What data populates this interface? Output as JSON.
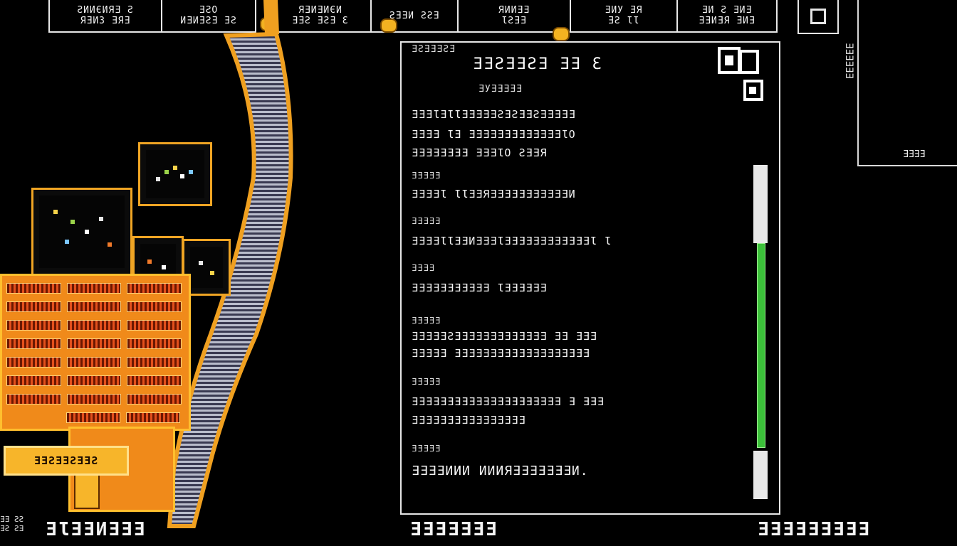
{
  "top_tabs": [
    {
      "line1": "ƧИИЄИЯƎ Ƨ",
      "line2": "ЯƎИЗ ƎЯƎ"
    },
    {
      "line1": "ƎƧO",
      "line2": "ИƎИƎƧƎ ƎƧ"
    },
    {
      "line1": "ЯƎИƎИЄИ",
      "line2": "ƎƎƧ ƎƧƎ Ɛ"
    },
    {
      "line1": "ƧƎƎИ ƧƧƎ",
      "line2": ""
    },
    {
      "line1": "ЯИИƎƎ",
      "line2": "ƖƧƎƎ"
    },
    {
      "line1": "ƎИУ ƎЯ",
      "line2": "ƎƧ ƖƖ"
    },
    {
      "line1": "ƎИ Ƨ ƎИƎ",
      "line2": "ƎƎИƎЯ ƎИƎ"
    }
  ],
  "left_scene": {
    "plate_label": "ƎƎƧƎƎƧƎƎƧ",
    "bottom_small": "ƎƎ ƧƧ\nƎƧ ƧƎ",
    "bottom_label": "ƎƖƎƎИƎƎƎ"
  },
  "info_panel": {
    "tag": "ƎƧƎƎƎƧƎ",
    "title": "ƎƎƧƎƎƧƎ ƎƎ Ɛ",
    "subtitle": "ƎУƎƎƎƎƎ",
    "intro_lines": [
      "ƎƎƎƖƎƖƖƎƎƎƎƎƧƎƧƎƎƧƎƎƎƎƎ",
      "ƎƎƎƎ ƖƎ ƎƎƎƎƎƎƎƎƎƎƎƎƎƖO",
      "ƎƎƎƎƎƎƎƎ ƎƎƎƖO ƧƎƎЯ"
    ],
    "sections": [
      {
        "label": "ƎƎƎƎƎ",
        "lines": [
          "ƎƎƎƎƖ ƖƖƎƎЯƎƎƎƎƎƎƎƎƎƎƎИ"
        ]
      },
      {
        "label": "ƎƎƎƎƎ",
        "lines": [
          "ƎƎƎƎƖƖƎƎИƎƎƎƖƎƎƎƎƎƎƎƎƎƎƎƎƖ Ɩ"
        ]
      },
      {
        "label": "ƎƎƎƎ",
        "lines": [
          "ƎƎƎƎƎƎƎƎƎƎƎ ƖƎƎƎƎƎƎ"
        ]
      },
      {
        "label": "ƎƎƎƎƎ",
        "lines": [
          "ƎƎƎƎƎƧƎƎƎƎƎƎƎƎƎƎƎƎƎ ƎƎ ƎƎƎ",
          "ƎƎƎƎƎ ƎƎƎƎƎƎƎƎƎƎƎƎƎƎƎƎƎƎƎ"
        ]
      },
      {
        "label": "ƎƎƎƎƎ",
        "lines": [
          "ƎƎƎƎƎƎƎƎƎƎƎƎƎƎƎƎƎƎƎƎƎ Ǝ ƎƎƎ",
          "ƎƎƎƎƎƎƎƎƎƎƎƎƎƎƎƎ"
        ]
      },
      {
        "label": "ƎƎƎƎƎ",
        "lines": [
          "ƎƎƎƎИИИ ИИИЯƎƎƎƎƎƎƎИ."
        ]
      }
    ],
    "scroll_fraction": 0.6,
    "bottom_label": "ƎƎƎƎƎƎƎ"
  },
  "right_panel": {
    "vertical_text": "ƎƎƎƎƎƎ",
    "corner_label": "ƎƎƎƎ",
    "bottom_label": "ƎƎƎƎƎƎƎƎƎ"
  },
  "colors": {
    "accent_gold": "#f3b221",
    "building_orange": "#f08a1a",
    "scroll_green": "#3cc03a"
  }
}
